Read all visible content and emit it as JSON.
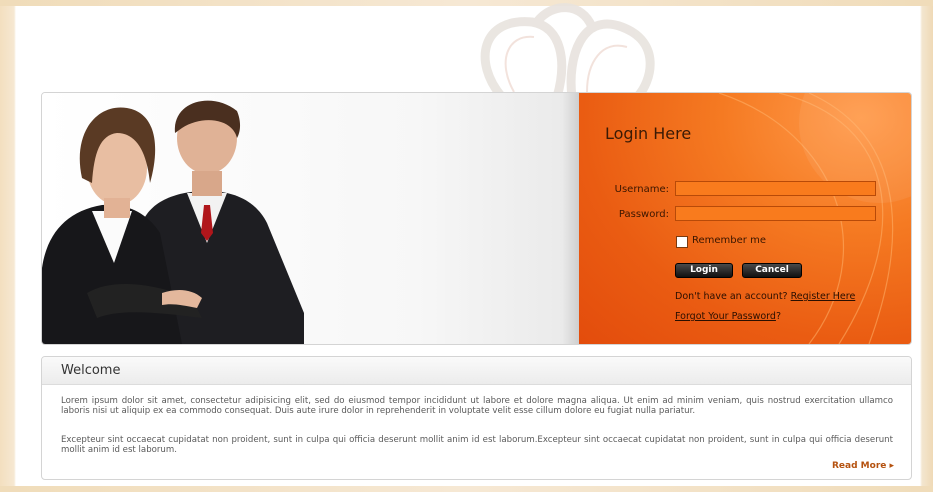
{
  "login": {
    "title": "Login Here",
    "username_label": "Username:",
    "username_value": "",
    "password_label": "Password:",
    "password_value": "",
    "remember_label": "Remember me",
    "login_button": "Login",
    "cancel_button": "Cancel",
    "no_account_text": "Don't have an account?",
    "register_link": "Register Here",
    "forgot_link": "Forgot Your Password",
    "forgot_suffix": "?"
  },
  "welcome": {
    "title": "Welcome",
    "paragraph1": "Lorem ipsum dolor sit amet, consectetur adipisicing elit, sed do eiusmod tempor incididunt ut labore et dolore magna aliqua. Ut enim ad minim veniam, quis nostrud exercitation ullamco laboris nisi ut aliquip ex ea commodo consequat. Duis aute irure dolor in reprehenderit in voluptate velit esse cillum dolore eu fugiat nulla pariatur.",
    "paragraph2": "Excepteur sint occaecat cupidatat non proident, sunt in culpa qui officia deserunt mollit anim id est laborum.Excepteur sint occaecat cupidatat non proident, sunt in culpa qui officia deserunt mollit anim id est laborum.",
    "read_more": "Read More ▸"
  },
  "colors": {
    "accent_orange": "#f57a22",
    "read_more": "#b5520f"
  },
  "icons": {
    "brand": "flower-logo-icon",
    "hero": "business-people-image"
  }
}
